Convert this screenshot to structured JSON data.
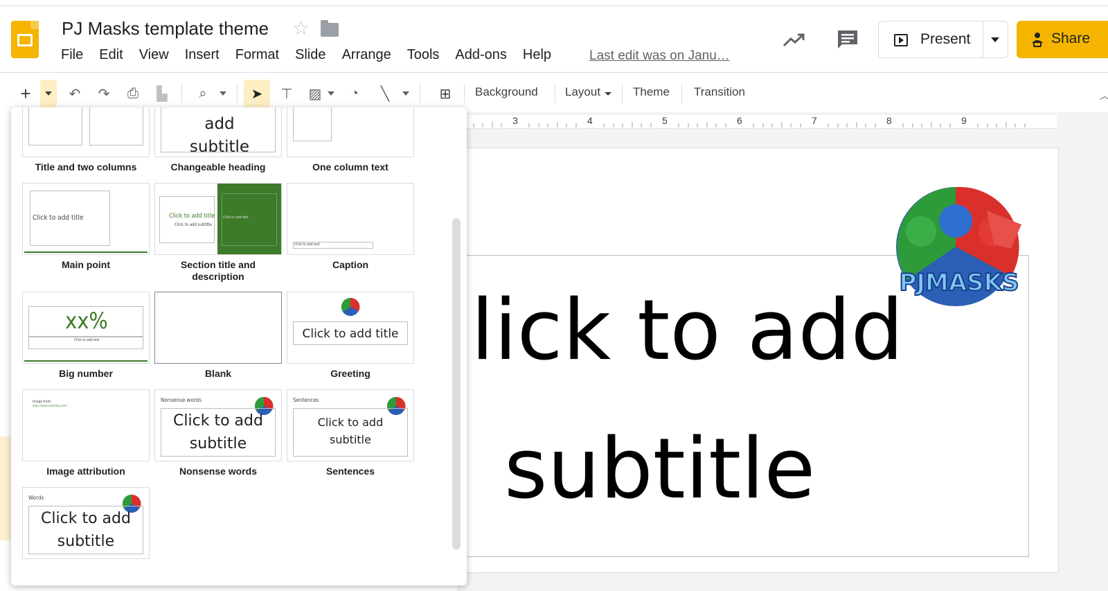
{
  "doc": {
    "title": "PJ Masks template theme",
    "last_edit": "Last edit was on Janu…"
  },
  "menu": [
    "File",
    "Edit",
    "View",
    "Insert",
    "Format",
    "Slide",
    "Arrange",
    "Tools",
    "Add-ons",
    "Help"
  ],
  "header": {
    "present_label": "Present",
    "share_label": "Share"
  },
  "toolbar": {
    "background": "Background",
    "layout": "Layout",
    "theme": "Theme",
    "transition": "Transition"
  },
  "ruler": [
    "3",
    "4",
    "5",
    "6",
    "7",
    "8",
    "9"
  ],
  "canvas": {
    "line1": "lick to add",
    "line2": "subtitle",
    "logo_text": "PJMASKS"
  },
  "layouts": [
    {
      "label": "Title and two columns"
    },
    {
      "label": "Changeable heading",
      "text": "Click to add subtitle"
    },
    {
      "label": "One column text"
    },
    {
      "label": "Main point",
      "text": "Click to add title"
    },
    {
      "label": "Section title and description",
      "text": "Click to add title",
      "sub": "Click to add subtitle",
      "side": "Click to add text"
    },
    {
      "label": "Caption",
      "text": "Click to add text"
    },
    {
      "label": "Big number",
      "text": "xx%",
      "sub": "Click to add text"
    },
    {
      "label": "Blank"
    },
    {
      "label": "Greeting",
      "text": "Click to add title"
    },
    {
      "label": "Image attribution",
      "text": "Image from:",
      "sub": "https://www.clipartkey.com/..."
    },
    {
      "label": "Nonsense words",
      "heading": "Nonsense words",
      "text": "Click to add subtitle"
    },
    {
      "label": "Sentences",
      "heading": "Sentences",
      "text": "Click to add subtitle"
    },
    {
      "label": "Words",
      "heading": "Words",
      "text": "Click to add subtitle"
    }
  ],
  "colors": {
    "accent": "#f4b400",
    "theme_green": "#3a7a26"
  }
}
